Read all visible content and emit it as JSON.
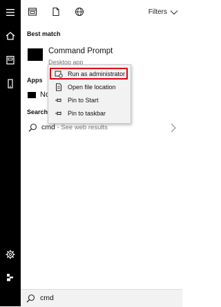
{
  "colors": {
    "rail_background": "#000000",
    "highlight_border": "#e0001a",
    "menu_background": "#f2f2f2"
  },
  "rail": {
    "items": [
      {
        "name": "hamburger-menu-icon"
      },
      {
        "name": "home-icon"
      },
      {
        "name": "documents-icon"
      },
      {
        "name": "mobile-device-icon"
      },
      {
        "name": "settings-gear-icon"
      },
      {
        "name": "account-icon"
      }
    ]
  },
  "top_bar": {
    "icons": [
      "apps-filter-icon",
      "documents-filter-icon",
      "web-filter-icon"
    ],
    "filters_label": "Filters"
  },
  "best_match": {
    "heading": "Best match",
    "title": "Command Prompt",
    "subtitle": "Desktop app"
  },
  "apps": {
    "heading": "Apps",
    "item_text": "No"
  },
  "search_section": {
    "heading": "Search",
    "query": "cmd",
    "hint": " - See web results"
  },
  "context_menu": {
    "items": [
      {
        "label": "Run as administrator",
        "icon": "run-as-admin-icon",
        "highlighted": true
      },
      {
        "label": "Open file location",
        "icon": "open-file-location-icon"
      },
      {
        "label": "Pin to Start",
        "icon": "pin-icon"
      },
      {
        "label": "Pin to taskbar",
        "icon": "pin-icon"
      }
    ]
  },
  "search_bar": {
    "value": "cmd"
  }
}
